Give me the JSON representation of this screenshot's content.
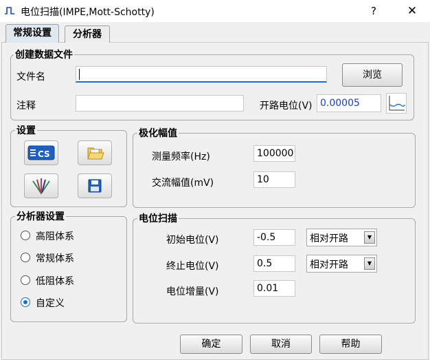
{
  "window": {
    "title": "电位扫描(IMPE,Mott-Schotty)",
    "help_label": "?",
    "close_label": "✕"
  },
  "tabs": [
    {
      "label": "常规设置",
      "active": true
    },
    {
      "label": "分析器",
      "active": false
    }
  ],
  "create_file": {
    "legend": "创建数据文件",
    "filename_label": "文件名",
    "filename_value": "",
    "browse_label": "浏览",
    "note_label": "注释",
    "note_value": "",
    "ocp_label": "开路电位(V)",
    "ocp_value": "0.00005"
  },
  "settings": {
    "legend": "设置",
    "icons": [
      "cs-instrument-icon",
      "open-folder-icon",
      "electrode-icon",
      "save-disk-icon"
    ]
  },
  "polarization": {
    "legend": "极化幅值",
    "freq_label": "测量频率(Hz)",
    "freq_value": "100000",
    "amp_label": "交流幅值(mV)",
    "amp_value": "10"
  },
  "analyzer": {
    "legend": "分析器设置",
    "options": [
      {
        "label": "高阻体系",
        "selected": false
      },
      {
        "label": "常规体系",
        "selected": false
      },
      {
        "label": "低阻体系",
        "selected": false
      },
      {
        "label": "自定义",
        "selected": true
      }
    ]
  },
  "scan": {
    "legend": "电位扫描",
    "start_label": "初始电位(V)",
    "start_value": "-0.5",
    "start_ref": "相对开路",
    "end_label": "终止电位(V)",
    "end_value": "0.5",
    "end_ref": "相对开路",
    "step_label": "电位增量(V)",
    "step_value": "0.01"
  },
  "footer": {
    "ok_label": "确定",
    "cancel_label": "取消",
    "help_label": "帮助"
  },
  "colors": {
    "accent": "#1a6fd6",
    "ocp_text": "#1a3fd6",
    "input_focus": "#1a6fd6"
  }
}
